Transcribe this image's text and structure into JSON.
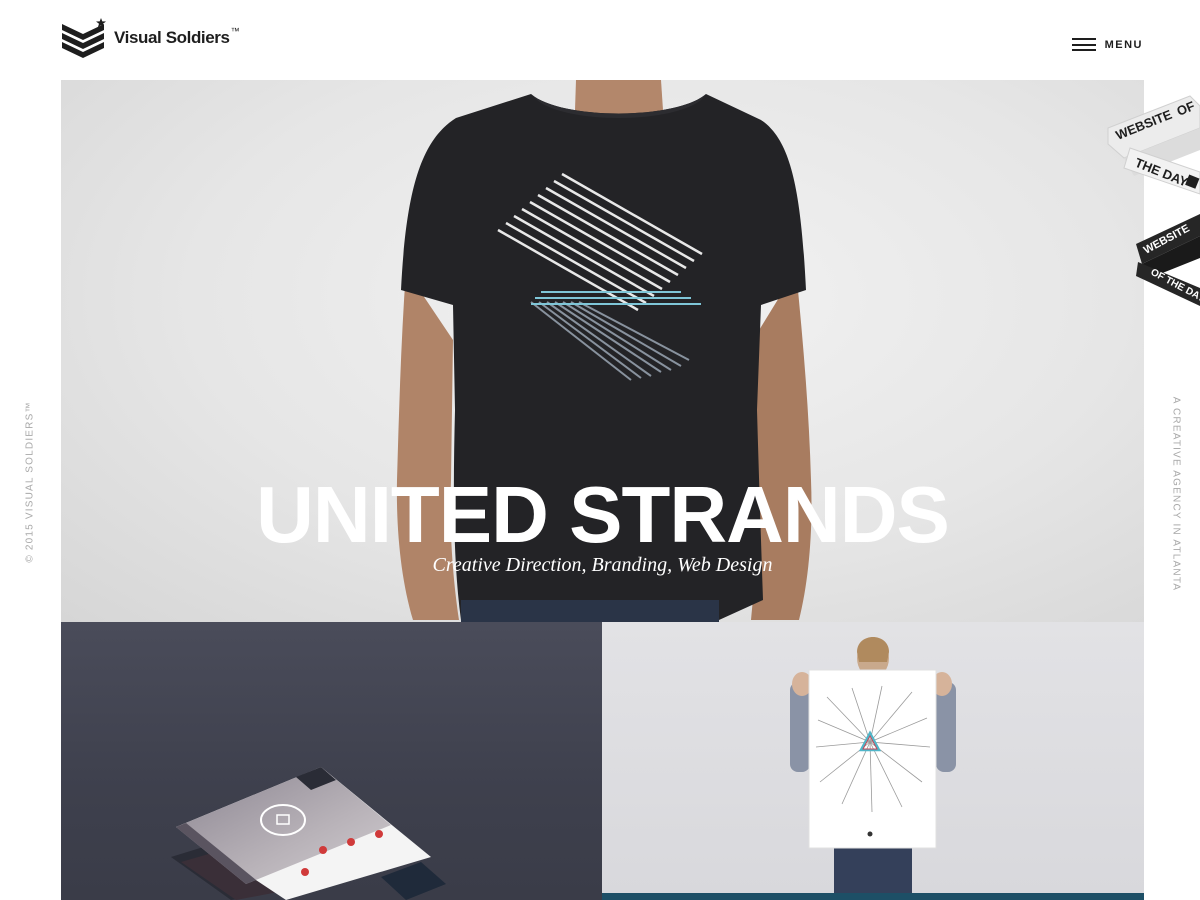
{
  "brand": {
    "name": "Visual Soldiers",
    "tm": "™",
    "logo_icon": "chevron-stripes-star-icon"
  },
  "nav": {
    "menu_label": "MENU",
    "menu_icon": "hamburger-icon"
  },
  "side": {
    "left_text": "© 2015 VISUAL SOLDIERS™",
    "right_text": "A CREATIVE AGENCY IN ATLANTA"
  },
  "hero": {
    "title": "UNITED STRANDS",
    "subtitle": "Creative Direction, Branding, Web Design"
  },
  "badges": {
    "badge_one": {
      "line1": "WEBSITE",
      "line1b": "OF",
      "line2": "THE DAY",
      "icon": "s-logo-icon"
    },
    "badge_two": {
      "line1": "WEBSITE",
      "line2": "OF THE DAY"
    }
  },
  "colors": {
    "text_dark": "#1e1e1e",
    "side_text": "#a8a8a8",
    "tile_left_bg": "#3e404d",
    "tile_right_bg": "#dcdce0",
    "accent_bar": "#1d4f66",
    "shirt": "#232326"
  }
}
